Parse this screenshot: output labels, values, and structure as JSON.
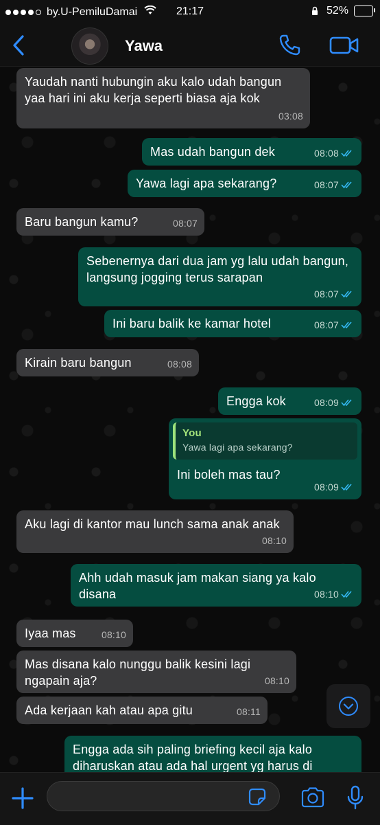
{
  "status_bar": {
    "carrier": "by.U-PemiluDamai",
    "time": "21:17",
    "battery": "52%"
  },
  "header": {
    "back_icon": "chevron-left-icon",
    "contact_name": "Yawa",
    "call_icon": "phone-icon",
    "video_icon": "video-icon"
  },
  "messages": [
    {
      "dir": "in",
      "text": "Yaudah nanti hubungin aku kalo udah bangun yaa hari ini aku kerja seperti biasa aja kok",
      "time": "03:08"
    },
    {
      "dir": "out",
      "text": "Mas udah bangun dek",
      "time": "08:08"
    },
    {
      "dir": "out",
      "text": "Yawa lagi apa sekarang?",
      "time": "08:07"
    },
    {
      "dir": "in",
      "text": "Baru bangun kamu?",
      "time": "08:07"
    },
    {
      "dir": "out",
      "text": "Sebenernya dari dua jam yg lalu udah bangun, langsung jogging terus sarapan",
      "time": "08:07"
    },
    {
      "dir": "out",
      "text": "Ini baru balik ke kamar hotel",
      "time": "08:07"
    },
    {
      "dir": "in",
      "text": "Kirain baru bangun",
      "time": "08:08"
    },
    {
      "dir": "out",
      "text": "Engga kok",
      "time": "08:09"
    },
    {
      "dir": "out",
      "quote_author": "You",
      "quote_text": "Yawa lagi apa sekarang?",
      "text": "Ini boleh mas tau?",
      "time": "08:09"
    },
    {
      "dir": "in",
      "text": "Aku lagi di kantor mau lunch sama anak anak",
      "time": "08:10"
    },
    {
      "dir": "out",
      "text": "Ahh udah masuk jam makan siang ya kalo disana",
      "time": "08:10"
    },
    {
      "dir": "in",
      "text": "Iyaa mas",
      "time": "08:10"
    },
    {
      "dir": "in",
      "text": "Mas disana kalo nunggu balik kesini lagi ngapain aja?",
      "time": "08:10"
    },
    {
      "dir": "in",
      "text": "Ada kerjaan kah atau apa gitu",
      "time": "08:11"
    },
    {
      "dir": "out",
      "text": "Engga ada sih paling briefing kecil aja kalo diharuskan atau ada hal urgent yg harus di",
      "time": ""
    }
  ],
  "scroll_down_icon": "chevron-down-circle-icon",
  "composer": {
    "plus_icon": "plus-icon",
    "input_value": "",
    "sticker_icon": "sticker-icon",
    "camera_icon": "camera-icon",
    "mic_icon": "microphone-icon"
  },
  "colors": {
    "accent": "#2f8cff",
    "incoming_bubble": "#3a3a3c",
    "outgoing_bubble": "#054d40",
    "read_tick": "#34b7f1"
  }
}
